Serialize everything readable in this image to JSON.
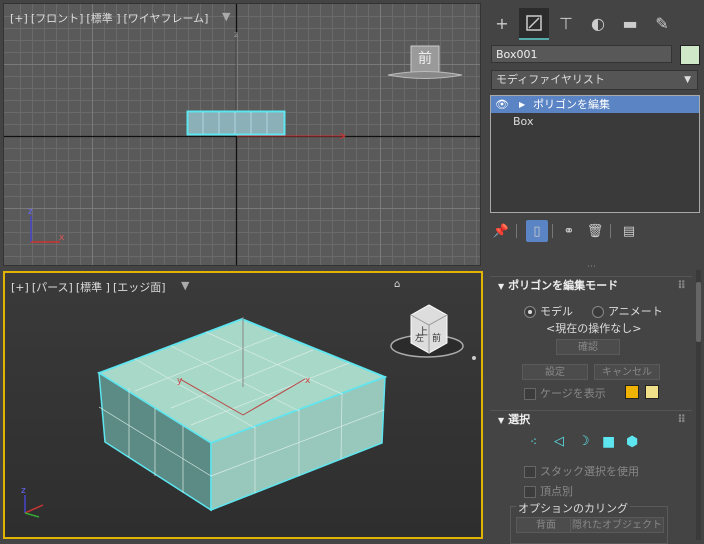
{
  "viewport_front": {
    "label_plus": "[+]",
    "label_view": "[フロント]",
    "label_shading": "[標準 ]",
    "label_mode": "[ワイヤフレーム]",
    "cube_label": "前"
  },
  "viewport_persp": {
    "label_plus": "[+]",
    "label_view": "[パース]",
    "label_shading": "[標準 ]",
    "label_mode": "[エッジ面]",
    "cube_face_front": "前",
    "cube_face_left": "左",
    "cube_face_top": "上"
  },
  "panel": {
    "object_name": "Box001",
    "object_color": "#cfe8c8",
    "modifier_list_label": "モディファイヤリスト",
    "stack": [
      {
        "label": "ポリゴンを編集",
        "selected": true
      },
      {
        "label": "Box",
        "selected": false
      }
    ],
    "rollout_edit_poly": {
      "title": "ポリゴンを編集モード",
      "radio_model": "モデル",
      "radio_animate": "アニメート",
      "current_op": "<現在の操作なし>",
      "commit_label": "確認",
      "settings_label": "設定",
      "cancel_label": "キャンセル",
      "show_cage_label": "ケージを表示",
      "cage_color_1": "#f0b400",
      "cage_color_2": "#f0e08a"
    },
    "rollout_selection": {
      "title": "選択",
      "use_stack_selection": "スタック選択を使用",
      "by_vertex": "頂点別",
      "culling_group": "オプションのカリング",
      "backface_label": "背面",
      "occluded_label": "隠れたオブジェクト"
    }
  },
  "colors": {
    "accent_blue": "#5b84c4",
    "active_viewport_border": "#e0b400",
    "selection_cyan": "#5ee6f0",
    "box_fill": "#a8d8c8"
  }
}
